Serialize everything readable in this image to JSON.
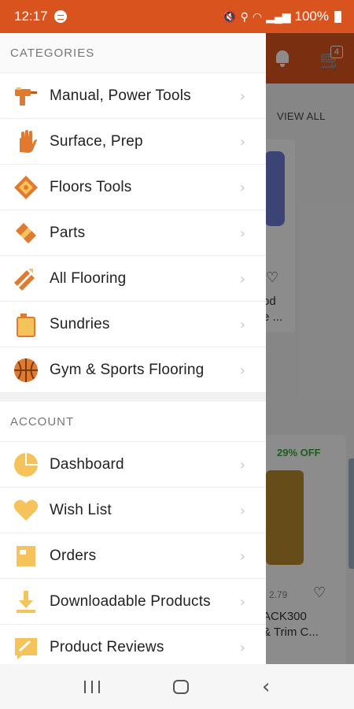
{
  "status_bar": {
    "time": "12:17",
    "battery": "100%"
  },
  "app": {
    "cart_count": "4",
    "view_all": "VIEW ALL",
    "product1_line1": "od",
    "product1_line2": "e ...",
    "discount": "29% OFF",
    "price2": "2.79",
    "product2_line1": "ACK300",
    "product2_line2": "& Trim C..."
  },
  "drawer": {
    "categories_title": "CATEGORIES",
    "categories": [
      {
        "label": "Manual, Power Tools",
        "icon": "power-drill-icon"
      },
      {
        "label": "Surface, Prep",
        "icon": "glove-icon"
      },
      {
        "label": "Floors Tools",
        "icon": "floor-tile-icon"
      },
      {
        "label": "Parts",
        "icon": "parts-icon"
      },
      {
        "label": "All Flooring",
        "icon": "flooring-planks-icon"
      },
      {
        "label": "Sundries",
        "icon": "jug-icon"
      },
      {
        "label": "Gym & Sports Flooring",
        "icon": "basketball-icon"
      }
    ],
    "account_title": "ACCOUNT",
    "account": [
      {
        "label": "Dashboard",
        "icon": "dashboard-icon"
      },
      {
        "label": "Wish List",
        "icon": "heart-icon"
      },
      {
        "label": "Orders",
        "icon": "orders-icon"
      },
      {
        "label": "Downloadable Products",
        "icon": "download-icon"
      },
      {
        "label": "Product Reviews",
        "icon": "reviews-icon"
      }
    ]
  },
  "colors": {
    "accent": "#e0561f",
    "icon_orange": "#e07a2e",
    "icon_yellow": "#f5c35a"
  }
}
